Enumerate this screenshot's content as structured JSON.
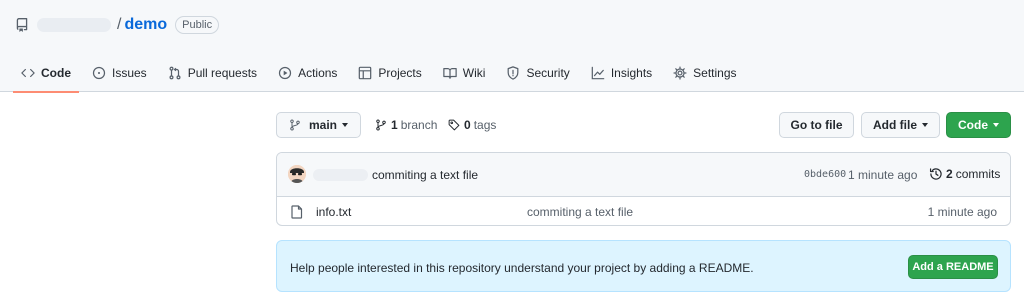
{
  "repo": {
    "name": "demo",
    "separator": "/",
    "visibility": "Public"
  },
  "tabs": [
    {
      "label": "Code",
      "icon": "code-icon",
      "selected": true
    },
    {
      "label": "Issues",
      "icon": "issue-opened-icon"
    },
    {
      "label": "Pull requests",
      "icon": "git-pull-request-icon"
    },
    {
      "label": "Actions",
      "icon": "play-icon"
    },
    {
      "label": "Projects",
      "icon": "table-icon"
    },
    {
      "label": "Wiki",
      "icon": "book-icon"
    },
    {
      "label": "Security",
      "icon": "shield-icon"
    },
    {
      "label": "Insights",
      "icon": "graph-icon"
    },
    {
      "label": "Settings",
      "icon": "gear-icon"
    }
  ],
  "toolbar": {
    "branch_selector": "main",
    "branch_count": "1",
    "branch_label": "branch",
    "tag_count": "0",
    "tag_label": "tags",
    "go_to_file": "Go to file",
    "add_file": "Add file",
    "code": "Code"
  },
  "latest_commit": {
    "message": "commiting a text file",
    "sha": "0bde600",
    "time": "1 minute ago",
    "commit_count": "2",
    "commit_label": "commits"
  },
  "files": [
    {
      "name": "info.txt",
      "last_commit": "commiting a text file",
      "age": "1 minute ago"
    }
  ],
  "readme_banner": {
    "text": "Help people interested in this repository understand your project by adding a README.",
    "button": "Add a README"
  },
  "colors": {
    "accent_link": "#0969da",
    "selected_tab_underline": "#fd8c73",
    "primary_button": "#2da44e",
    "banner_background": "#ddf4ff"
  }
}
